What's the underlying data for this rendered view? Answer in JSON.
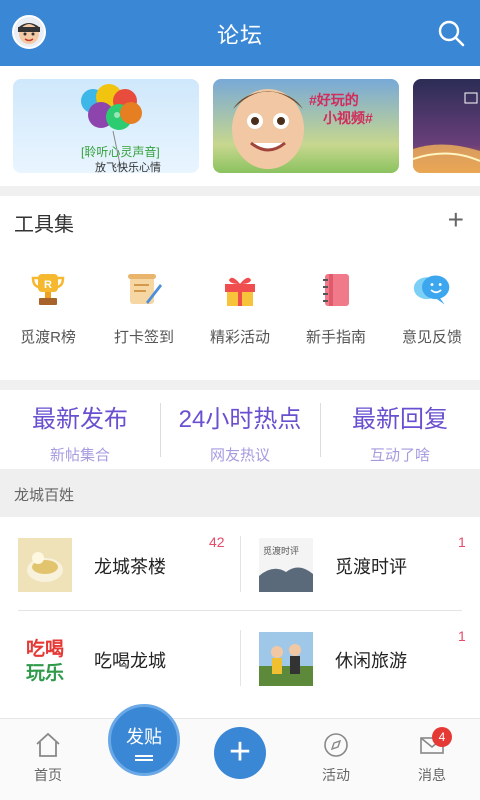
{
  "header": {
    "title": "论坛"
  },
  "banner": {
    "card1": {
      "tag": "[聆听心灵声音]",
      "subtitle": "放飞快乐心情"
    },
    "card2": {
      "text_line1": "#好玩的",
      "text_line2": "小视频#"
    }
  },
  "tools": {
    "title": "工具集",
    "add_label": "+",
    "items": [
      {
        "label": "觅渡R榜",
        "icon": "trophy-icon"
      },
      {
        "label": "打卡签到",
        "icon": "scroll-pen-icon"
      },
      {
        "label": "精彩活动",
        "icon": "gift-icon"
      },
      {
        "label": "新手指南",
        "icon": "notebook-icon"
      },
      {
        "label": "意见反馈",
        "icon": "chat-bubble-icon"
      }
    ]
  },
  "highlights": [
    {
      "title": "最新发布",
      "sub": "新帖集合"
    },
    {
      "title": "24小时热点",
      "sub": "网友热议"
    },
    {
      "title": "最新回复",
      "sub": "互动了啥"
    }
  ],
  "section": {
    "label": "龙城百姓"
  },
  "forums": [
    {
      "name": "龙城茶楼",
      "count": "42"
    },
    {
      "name": "觅渡时评",
      "count": "1"
    },
    {
      "name": "吃喝龙城",
      "count": ""
    },
    {
      "name": "休闲旅游",
      "count": "1"
    }
  ],
  "forum_img_text": {
    "eat": "吃喝",
    "play": "玩乐",
    "midu": "觅渡时评"
  },
  "bottom_nav": {
    "home": "首页",
    "post": "发贴",
    "plus": "+",
    "activity": "活动",
    "messages": "消息",
    "badge": "4"
  },
  "colors": {
    "primary": "#3a87d5",
    "accent_purple": "#6a4fd0",
    "badge_red": "#e53935"
  }
}
